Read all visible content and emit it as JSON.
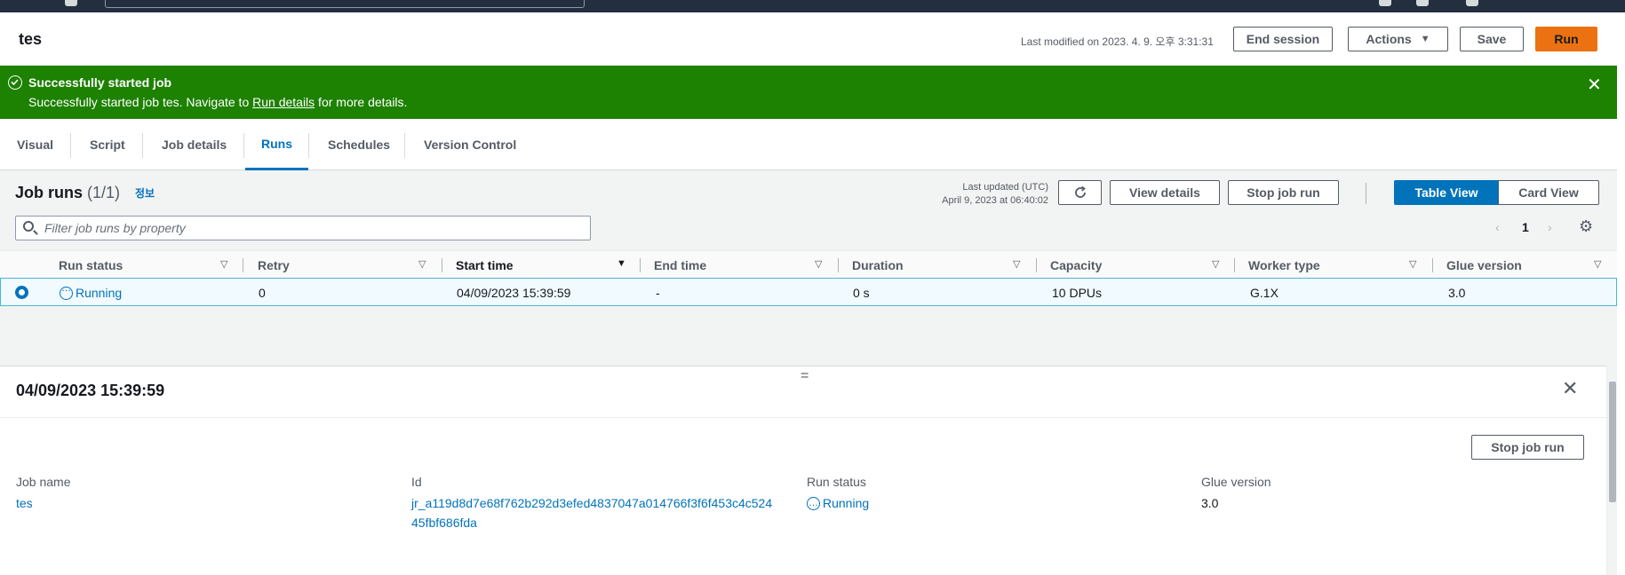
{
  "header": {
    "title": "tes",
    "last_modified": "Last modified on 2023. 4. 9. 오후 3:31:31",
    "end_session": "End session",
    "actions": "Actions",
    "save": "Save",
    "run": "Run"
  },
  "flash": {
    "title": "Successfully started job",
    "message_prefix": "Successfully started job tes. Navigate to ",
    "message_link": "Run details",
    "message_suffix": " for more details.",
    "colors": {
      "background": "#1d8102"
    }
  },
  "tabs": [
    "Visual",
    "Script",
    "Job details",
    "Runs",
    "Schedules",
    "Version Control"
  ],
  "active_tab": "Runs",
  "runs": {
    "title": "Job runs",
    "count": "(1/1)",
    "info_link": "정보",
    "last_updated_label": "Last updated (UTC)",
    "last_updated_value": "April 9, 2023 at 06:40:02",
    "refresh_icon": "refresh-icon",
    "view_details": "View details",
    "stop_job_run": "Stop job run",
    "table_view": "Table View",
    "card_view": "Card View",
    "filter_placeholder": "Filter job runs by property",
    "page": "1",
    "columns": [
      "Run status",
      "Retry",
      "Start time",
      "End time",
      "Duration",
      "Capacity",
      "Worker type",
      "Glue version"
    ],
    "rows": [
      {
        "run_status": "Running",
        "retry": "0",
        "start_time": "04/09/2023 15:39:59",
        "end_time": "-",
        "duration": "0 s",
        "capacity": "10 DPUs",
        "worker_type": "G.1X",
        "glue_version": "3.0"
      }
    ]
  },
  "detail": {
    "title": "04/09/2023 15:39:59",
    "stop_job_run": "Stop job run",
    "job_name_label": "Job name",
    "job_name_value": "tes",
    "id_label": "Id",
    "id_value_line1": "jr_a119d8d7e68f762b292d3efed4837047a014766f3f6f453c4c524",
    "id_value_line2": "45fbf686fda",
    "run_status_label": "Run status",
    "run_status_value": "Running",
    "glue_version_label": "Glue version",
    "glue_version_value": "3.0"
  },
  "colors": {
    "accent": "#0073bb",
    "primary_button": "#ec7211",
    "success": "#1d8102",
    "top_nav": "#232f3e"
  }
}
